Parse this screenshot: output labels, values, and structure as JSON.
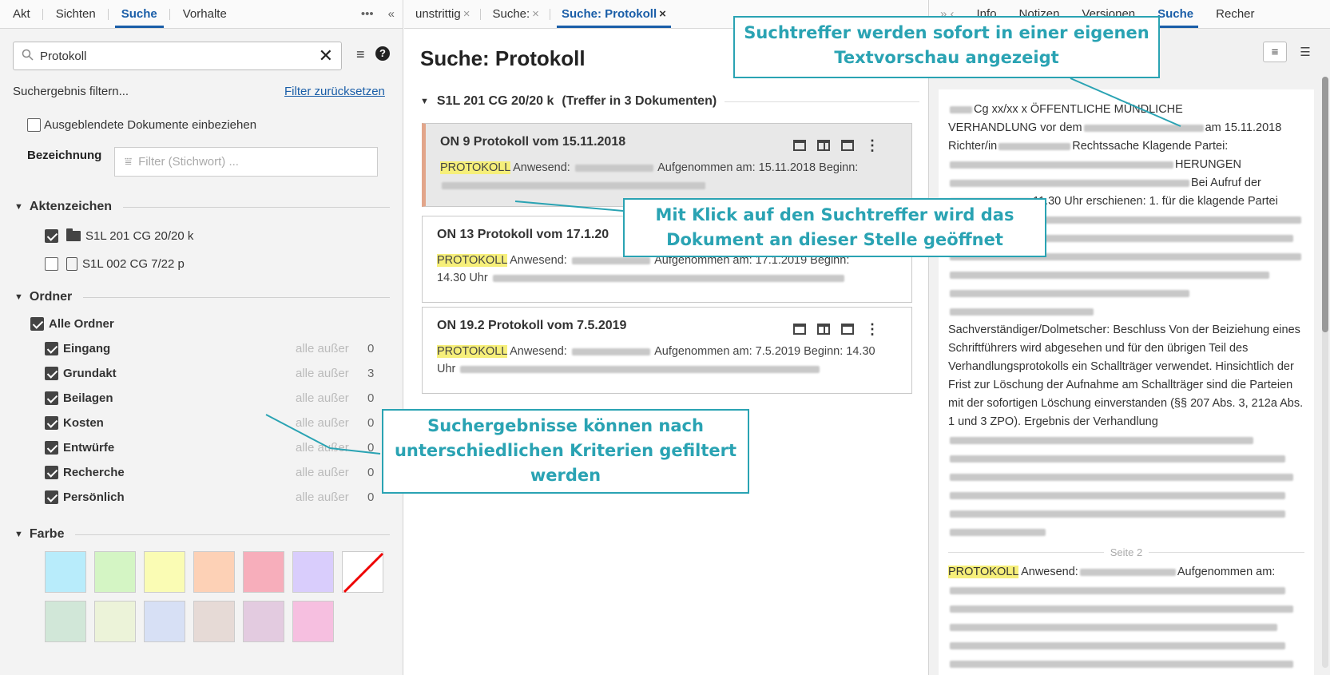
{
  "left": {
    "tabs": [
      "Akt",
      "Sichten",
      "Suche",
      "Vorhalte"
    ],
    "active_tab": "Suche",
    "search_value": "Protokoll",
    "filter_title": "Suchergebnis filtern...",
    "reset_link": "Filter zurücksetzen",
    "hidden_docs_label": "Ausgeblendete Dokumente einbeziehen",
    "bezeichnung_label": "Bezeichnung",
    "bezeichnung_placeholder": "Filter (Stichwort) ...",
    "aktenzeichen": {
      "title": "Aktenzeichen",
      "items": [
        {
          "label": "S1L 201 CG 20/20 k",
          "checked": true,
          "icon": "folder-icon"
        },
        {
          "label": "S1L 002 CG 7/22 p",
          "checked": false,
          "icon": "linked-document-icon"
        }
      ]
    },
    "ordner": {
      "title": "Ordner",
      "all_label": "Alle Ordner",
      "except_label": "alle außer",
      "items": [
        {
          "label": "Eingang",
          "count": "0"
        },
        {
          "label": "Grundakt",
          "count": "3"
        },
        {
          "label": "Beilagen",
          "count": "0"
        },
        {
          "label": "Kosten",
          "count": "0"
        },
        {
          "label": "Entwürfe",
          "count": "0"
        },
        {
          "label": "Recherche",
          "count": "0"
        },
        {
          "label": "Persönlich",
          "count": "0"
        }
      ]
    },
    "farbe": {
      "title": "Farbe",
      "colors": [
        "#b8ecfb",
        "#d4f5c4",
        "#fafcb4",
        "#fdd1b6",
        "#f7aebb",
        "#d9cdfc",
        "none",
        "#d1e7d8",
        "#ecf3d9",
        "#d7e0f5",
        "#e6dad6",
        "#e3cbe0",
        "#f6bfe0"
      ]
    }
  },
  "middle": {
    "tabs": [
      {
        "label": "unstrittig",
        "closable": true
      },
      {
        "label": "Suche:",
        "closable": true
      },
      {
        "label": "Suche: Protokoll",
        "closable": true,
        "active": true
      }
    ],
    "title": "Suche: Protokoll",
    "group": {
      "case": "S1L 201 CG 20/20 k",
      "hits": "(Treffer in 3 Dokumenten)"
    },
    "results": [
      {
        "title": "ON 9 Protokoll vom 15.11.2018",
        "highlight": "PROTOKOLL",
        "text1": "Anwesend:",
        "text2": "Aufgenommen am: 15.11.2018 Beginn:",
        "line2": ""
      },
      {
        "title": "ON 13 Protokoll vom 17.1.20",
        "highlight": "PROTOKOLL",
        "text1": "Anwesend:",
        "text2": "Aufgenommen am: 17.1.2019 Beginn:",
        "line2": "14.30 Uhr"
      },
      {
        "title": "ON 19.2 Protokoll vom 7.5.2019",
        "highlight": "PROTOKOLL",
        "text1": "Anwesend:",
        "text2": "Aufgenommen am: 7.5.2019 Beginn: 14.30",
        "line2": "Uhr"
      }
    ]
  },
  "right": {
    "tabs": [
      "Info",
      "Notizen",
      "Versionen",
      "Suche",
      "Recher"
    ],
    "active_tab": "Suche",
    "preview": {
      "l1": "Cg xx/xx x ÖFFENTLICHE MÜNDLICHE",
      "l2a": "VERHANDLUNG vor dem",
      "l2b": "am 15.11.2018",
      "l3a": "Richter/in",
      "l3b": "Rechtssache Klagende Partei:",
      "l4": "HERUNGEN",
      "l5": "Bei Aufruf der",
      "l6": "11.30 Uhr erschienen: 1. für die klagende Partei",
      "p2": "Sachverständiger/Dolmetscher: Beschluss Von der Beiziehung eines Schriftführers wird abgesehen und für den übrigen Teil des Verhandlungsprotokolls ein Schallträger verwendet. Hinsichtlich der Frist zur Löschung der Aufnahme am Schallträger sind die Parteien mit der sofortigen Löschung einverstanden (§§ 207 Abs. 3, 212a Abs. 1 und 3 ZPO). Ergebnis der Verhandlung",
      "page_label": "Seite 2",
      "p3_highlight": "PROTOKOLL",
      "p3a": "Anwesend:",
      "p3b": "Aufgenommen am:"
    }
  },
  "callouts": {
    "top": "Suchtreffer werden sofort in einer eigenen Textvorschau angezeigt",
    "middle": "Mit Klick auf den Suchtreffer wird das Dokument an dieser Stelle geöffnet",
    "bottom": "Suchergebnisse können nach unterschiedlichen Kriterien gefiltert werden"
  },
  "accent_color": "#1a5ea8",
  "callout_color": "#2aa3b3"
}
